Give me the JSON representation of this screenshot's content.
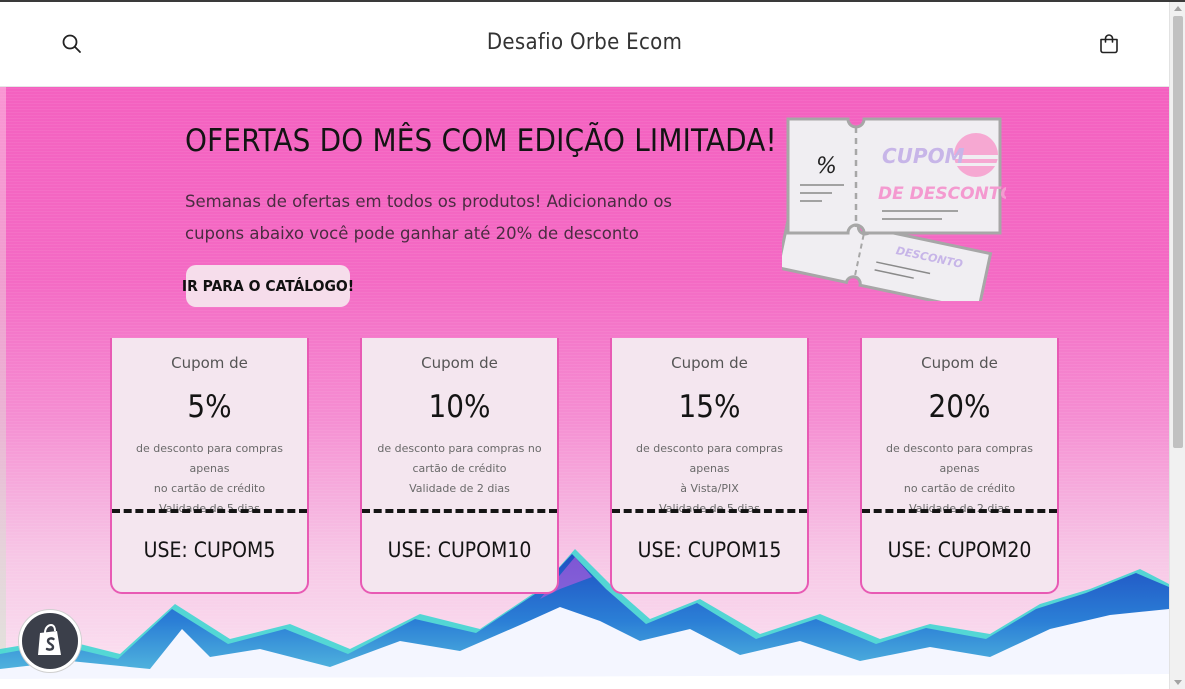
{
  "header": {
    "title": "Desafio Orbe Ecom",
    "search_icon": "search-icon",
    "cart_icon": "cart-icon"
  },
  "banner": {
    "title": "OFERTAS DO MÊS COM EDIÇÃO LIMITADA!",
    "text": "Semanas de ofertas em todos os produtos! Adicionando os cupons abaixo você pode ganhar até 20% de desconto",
    "cta_label": "IR PARA O CATÁLOGO!",
    "illustration": {
      "percent": "%",
      "line1": "CUPOM",
      "line2": "DE DESCONTO"
    }
  },
  "coupons": [
    {
      "label": "Cupom de",
      "value": "5%",
      "desc1": "de desconto para compras apenas",
      "desc2": "no cartão de crédito",
      "validity": "Validade de 5 dias",
      "code": "USE: CUPOM5"
    },
    {
      "label": "Cupom de",
      "value": "10%",
      "desc1": "de desconto para compras no",
      "desc2": "cartão de crédito",
      "validity": "Validade de 2 dias",
      "code": "USE: CUPOM10"
    },
    {
      "label": "Cupom de",
      "value": "15%",
      "desc1": "de desconto para compras apenas",
      "desc2": "à Vista/PIX",
      "validity": "Validade de 5 dias",
      "code": "USE: CUPOM15"
    },
    {
      "label": "Cupom de",
      "value": "20%",
      "desc1": "de desconto para compras apenas",
      "desc2": "no cartão de crédito",
      "validity": "Validade de 2 dias",
      "code": "USE: CUPOM20"
    }
  ],
  "colors": {
    "banner_pink": "#f461c0",
    "coupon_border": "#e85ab4",
    "coupon_bg": "#f4e6ef",
    "cta_bg": "#f6ddeb",
    "badge_bg": "#3b3f4a"
  },
  "shopify_badge": {
    "icon": "shopify-bag-icon"
  }
}
